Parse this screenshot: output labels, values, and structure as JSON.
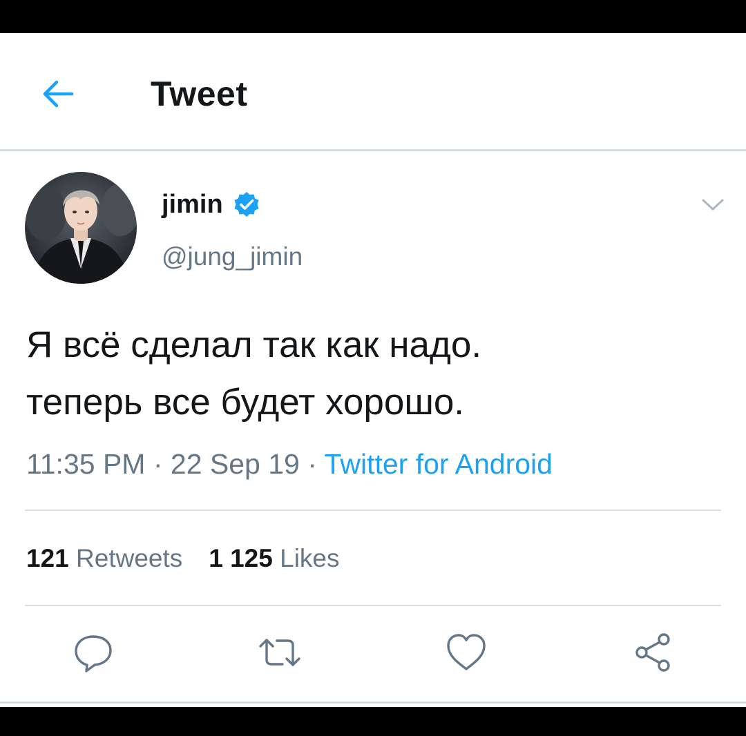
{
  "header": {
    "title": "Tweet"
  },
  "author": {
    "display_name": "jimin",
    "handle": "@jung_jimin",
    "verified": true
  },
  "tweet": {
    "lines": [
      "Я всё сделал так как надо.",
      "теперь все будет хорошо."
    ],
    "time": "11:35 PM",
    "date": "22 Sep 19",
    "source": "Twitter for Android",
    "separator": " · "
  },
  "stats": {
    "retweets_count": "121",
    "retweets_label": "Retweets",
    "likes_count": "1 125",
    "likes_label": "Likes"
  },
  "icons": {
    "back": "arrow-left-icon",
    "verified": "verified-badge-icon",
    "caret": "chevron-down-icon",
    "reply": "reply-icon",
    "retweet": "retweet-icon",
    "like": "heart-icon",
    "share": "share-icon"
  },
  "colors": {
    "accent": "#1da1f2",
    "text": "#14171a",
    "secondary": "#657786",
    "divider": "#d8dee3"
  }
}
